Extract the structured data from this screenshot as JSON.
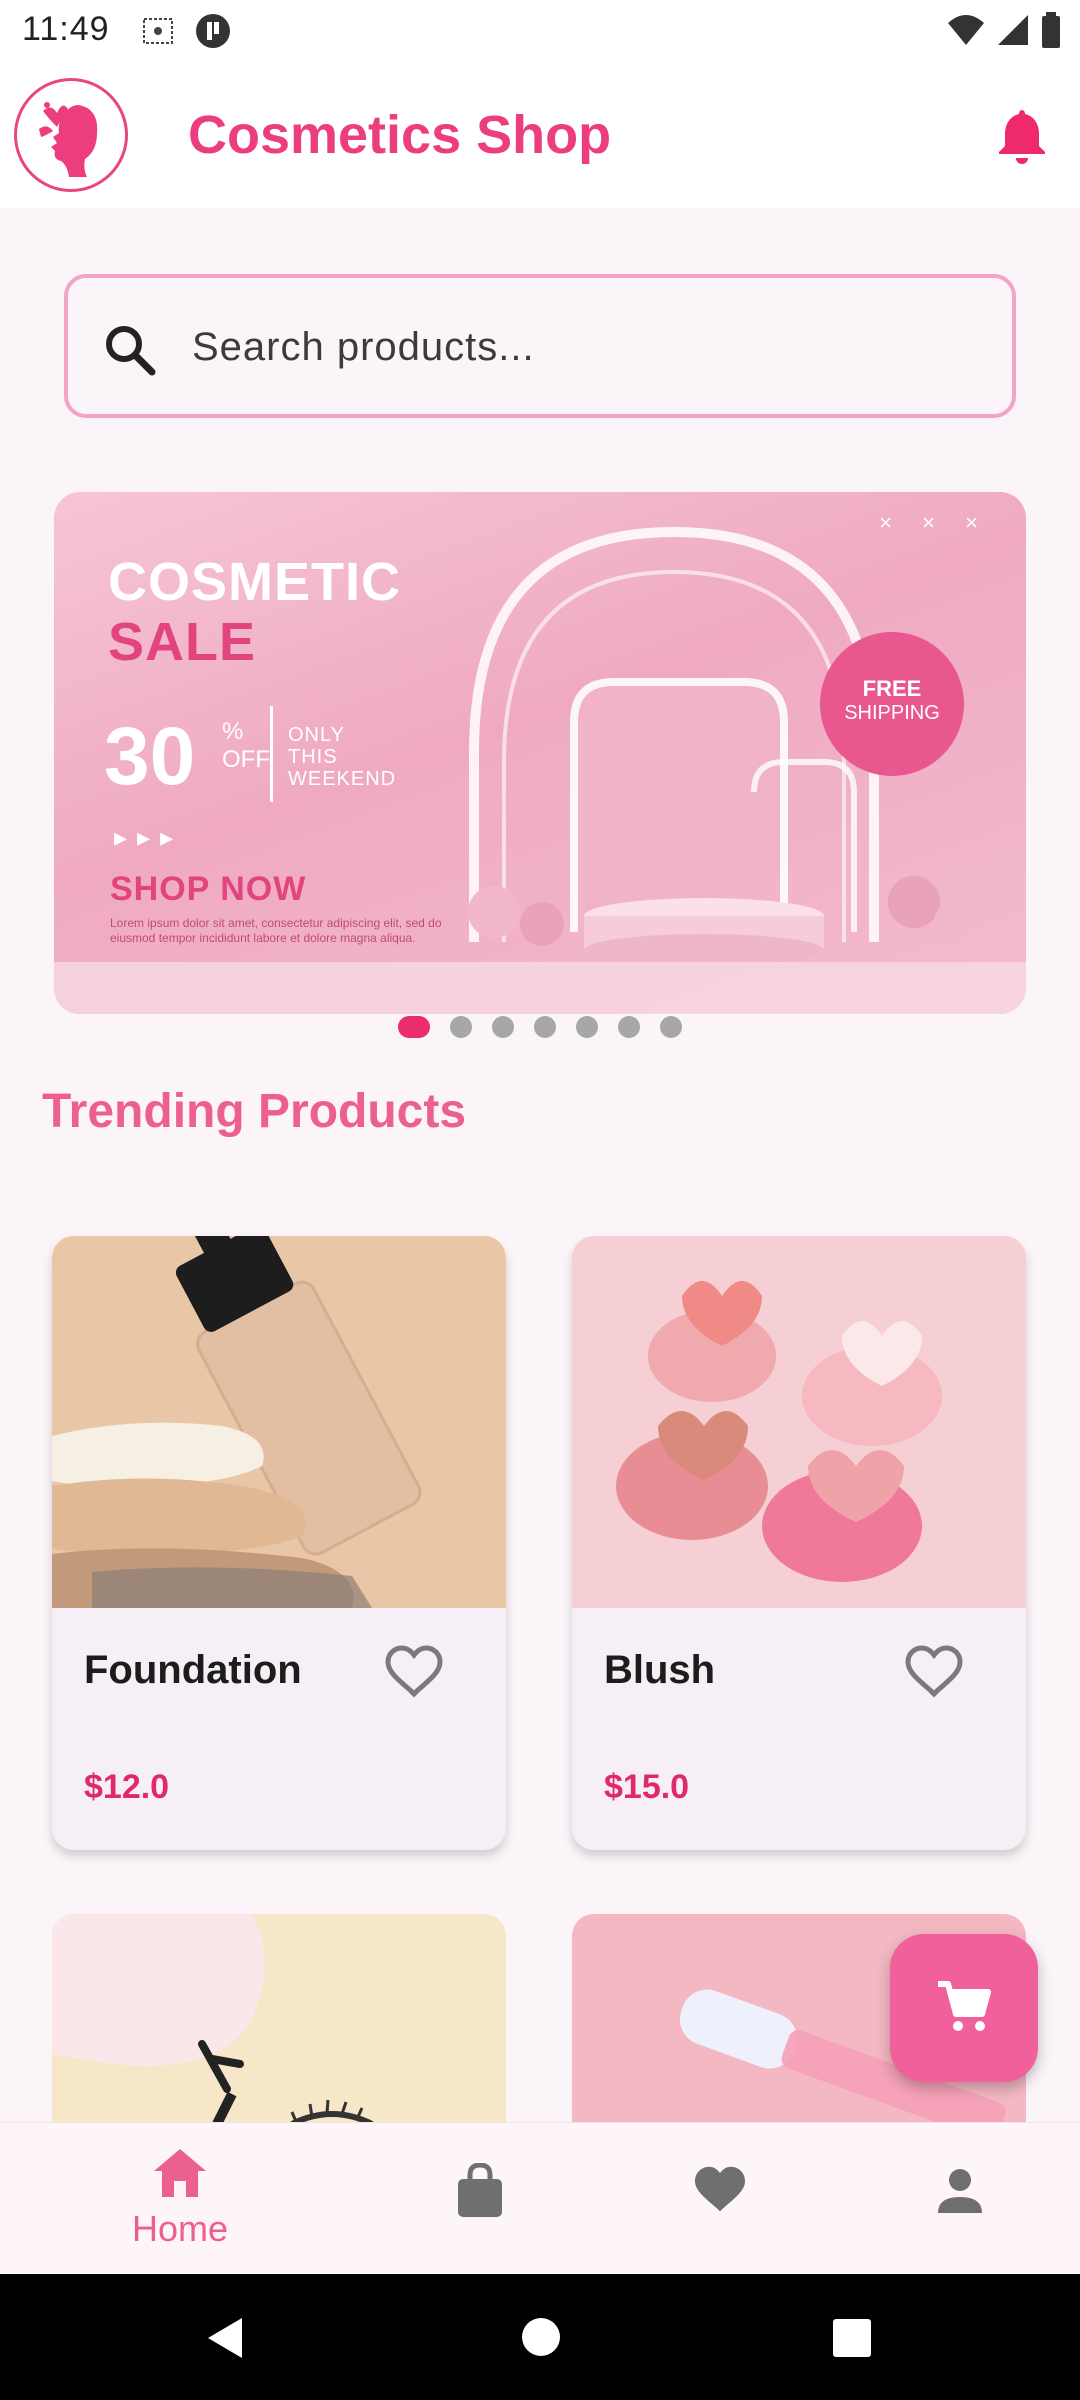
{
  "status_bar": {
    "time": "11:49"
  },
  "app_bar": {
    "title": "Cosmetics Shop"
  },
  "search": {
    "placeholder": "Search products..."
  },
  "banner": {
    "headline_1": "COSMETIC",
    "headline_2": "SALE",
    "percent": "30",
    "percent_symbol": "%",
    "off": "OFF",
    "side_1": "ONLY",
    "side_2": "THIS",
    "side_3": "WEEKEND",
    "arrows": "▸▸▸",
    "cta": "SHOP NOW",
    "lorem": "Lorem ipsum dolor sit amet, consectetur adipiscing elit, sed do eiusmod tempor incididunt labore et dolore magna aliqua.",
    "badge_1": "FREE",
    "badge_2": "SHIPPING",
    "close_marks": "× × ×"
  },
  "carousel": {
    "count": 7,
    "active": 0
  },
  "trending": {
    "title": "Trending Products",
    "products": [
      {
        "name": "Foundation",
        "price": "$12.0"
      },
      {
        "name": "Blush",
        "price": "$15.0"
      }
    ]
  },
  "bottom_nav": {
    "items": [
      {
        "label": "Home",
        "icon": "home-icon",
        "active": true
      },
      {
        "label": "",
        "icon": "shopping-bag-icon",
        "active": false
      },
      {
        "label": "",
        "icon": "heart-icon",
        "active": false
      },
      {
        "label": "",
        "icon": "person-icon",
        "active": false
      }
    ]
  },
  "colors": {
    "primary": "#ec3d7e",
    "section_title": "#ec5f91",
    "price": "#e0286d",
    "fab": "#f0609a",
    "nav_inactive": "#6f6f6f"
  }
}
